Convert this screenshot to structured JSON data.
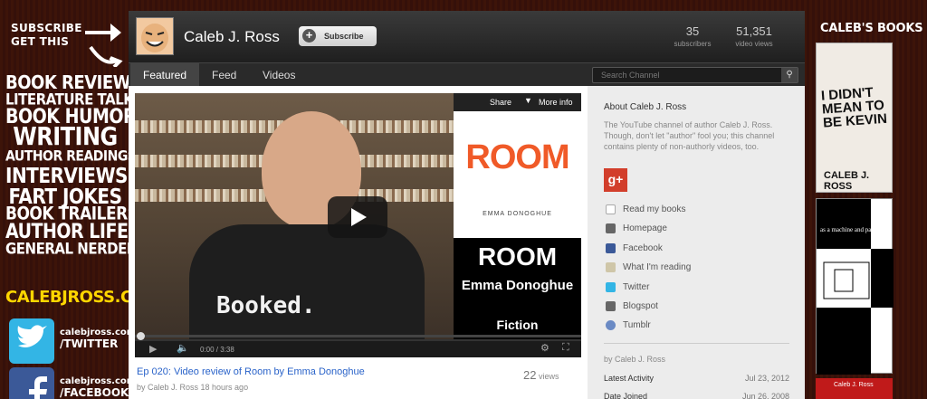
{
  "left_banner": {
    "subscribe_line1": "SUBSCRIBE",
    "subscribe_line2": "GET THIS",
    "topics": [
      "BOOK REVIEWS",
      "LITERATURE TALK",
      "BOOK HUMOR",
      "WRITING",
      "AUTHOR READINGS",
      "INTERVIEWS",
      "FART JOKES",
      "BOOK TRAILERS",
      "AUTHOR LIFE",
      "GENERAL NERDERY"
    ],
    "site": "CALEBJROSS.COM",
    "twitter": {
      "line1": "calebjross.com",
      "line2": "/TWITTER"
    },
    "facebook": {
      "line1": "calebjross.com",
      "line2": "/FACEBOOK"
    }
  },
  "channel": {
    "name": "Caleb J. Ross",
    "subscribe_label": "Subscribe",
    "subscribers": "35",
    "subscribers_label": "subscribers",
    "video_views": "51,351",
    "video_views_label": "video views"
  },
  "nav": {
    "tabs": [
      "Featured",
      "Feed",
      "Videos"
    ],
    "search_placeholder": "Search Channel"
  },
  "video": {
    "share_label": "Share",
    "more_info_label": "More info",
    "time": "0:00 / 3:38",
    "shirt_text": "Booked.",
    "cover_title": "ROOM",
    "cover_author": "EMMA DONOGHUE",
    "overlay_title": "ROOM",
    "overlay_author": "Emma Donoghue",
    "overlay_category": "Fiction",
    "title": "Ep 020: Video review of Room by Emma Donoghue",
    "meta": "by Caleb J. Ross 18 hours ago",
    "views_count": "22",
    "views_label": "views"
  },
  "about": {
    "heading": "About Caleb J. Ross",
    "text": "The YouTube channel of author Caleb J. Ross. Though, don't let \"author\" fool you; this channel contains plenty of non-authorly videos, too.",
    "links": [
      "Read my books",
      "Homepage",
      "Facebook",
      "What I'm reading",
      "Twitter",
      "Blogspot",
      "Tumblr"
    ],
    "by": "by Caleb J. Ross",
    "latest_activity_label": "Latest Activity",
    "latest_activity_value": "Jul 23, 2012",
    "date_joined_label": "Date Joined",
    "date_joined_value": "Jun 26, 2008"
  },
  "right_banner": {
    "title": "CALEB'S BOOKS",
    "book1_title": "I DIDN'T MEAN TO BE KEVIN",
    "book1_author": "CALEB J. ROSS",
    "book2_title": "as a machine and parts",
    "book3_title": "Caleb J. Ross"
  },
  "colors": {
    "link_blue": "#2a63c9",
    "gplus_red": "#d23e2b",
    "site_yellow": "#ffd600"
  }
}
